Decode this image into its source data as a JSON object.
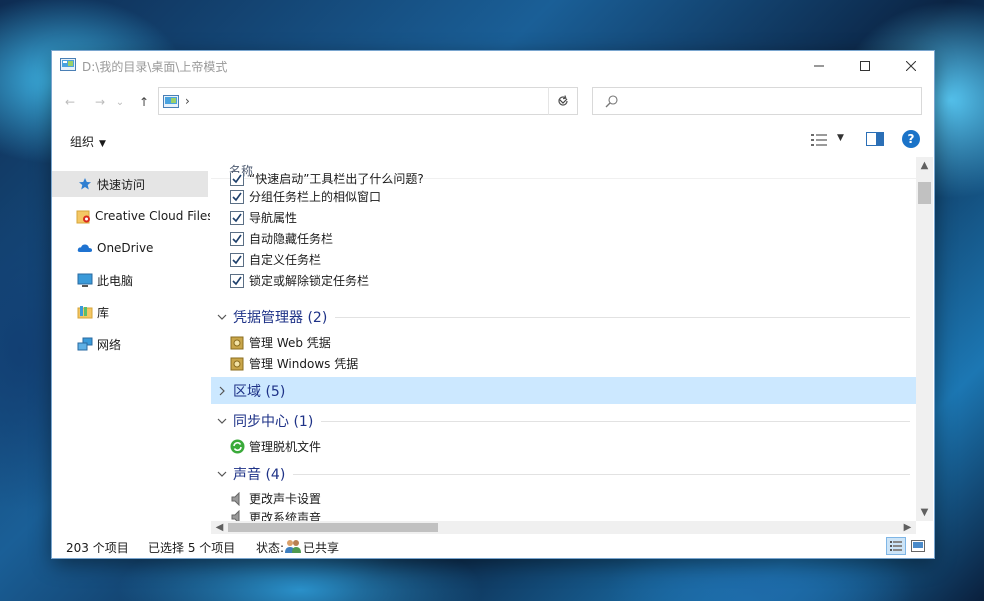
{
  "window": {
    "title": "D:\\我的目录\\桌面\\上帝模式",
    "controls": {
      "minimize_icon": "—",
      "maximize_icon": "☐",
      "close_icon": "✕"
    }
  },
  "address": {
    "back_icon": "←",
    "forward_icon": "→",
    "recent_icon": "⌄",
    "up_icon": "↑",
    "separator": "›",
    "dropdown_icon": "⌄",
    "refresh_icon": "↻",
    "search_placeholder": ""
  },
  "toolbar": {
    "organize_label": "组织",
    "organize_caret": "▼",
    "help_label": "?",
    "view_caret": "▼"
  },
  "sidebar": {
    "items": [
      {
        "label": "快速访问",
        "icon": "star-icon",
        "selected": true
      },
      {
        "label": "Creative Cloud Files",
        "icon": "creative-cloud-folder-icon"
      },
      {
        "label": "OneDrive",
        "icon": "cloud-icon"
      },
      {
        "label": "此电脑",
        "icon": "computer-icon"
      },
      {
        "label": "库",
        "icon": "library-icon"
      },
      {
        "label": "网络",
        "icon": "network-icon"
      }
    ]
  },
  "content": {
    "column_header": "名称",
    "sort_caret": "^",
    "items_top": [
      {
        "label": "“快速启动”工具栏出了什么问题?",
        "icon": "taskbar-checkbox-icon"
      },
      {
        "label": "分组任务栏上的相似窗口",
        "icon": "taskbar-checkbox-icon"
      },
      {
        "label": "导航属性",
        "icon": "taskbar-checkbox-icon"
      },
      {
        "label": "自动隐藏任务栏",
        "icon": "taskbar-checkbox-icon"
      },
      {
        "label": "自定义任务栏",
        "icon": "taskbar-checkbox-icon"
      },
      {
        "label": "锁定或解除锁定任务栏",
        "icon": "taskbar-checkbox-icon"
      }
    ],
    "groups": [
      {
        "label": "凭据管理器 (2)",
        "expanded": true,
        "items": [
          {
            "label": "管理 Web 凭据",
            "icon": "credential-vault-icon"
          },
          {
            "label": "管理 Windows 凭据",
            "icon": "credential-vault-icon"
          }
        ]
      },
      {
        "label": "区域 (5)",
        "expanded": false,
        "selected": true,
        "items": []
      },
      {
        "label": "同步中心 (1)",
        "expanded": true,
        "items": [
          {
            "label": "管理脱机文件",
            "icon": "sync-icon"
          }
        ]
      },
      {
        "label": "声音 (4)",
        "expanded": true,
        "items": [
          {
            "label": "更改声卡设置",
            "icon": "speaker-icon"
          },
          {
            "label": "更改系统声音",
            "icon": "speaker-icon"
          }
        ]
      }
    ]
  },
  "status": {
    "count": "203 个项目",
    "selected": "已选择 5 个项目",
    "state_label": "状态:",
    "state_value": "已共享"
  },
  "colors": {
    "accent": "#1a73c8",
    "group_header": "#1e3287",
    "selection": "#cce8ff"
  }
}
